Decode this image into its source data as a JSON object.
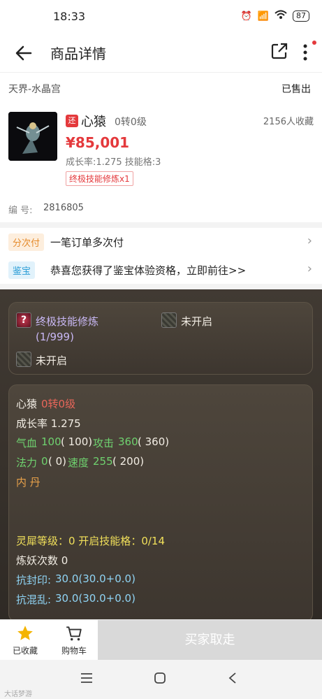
{
  "status_bar": {
    "time": "18:33",
    "battery": "87"
  },
  "header": {
    "title": "商品详情"
  },
  "server": {
    "name": "天界-水晶宫",
    "status": "已售出"
  },
  "product": {
    "tag": "还",
    "name": "心猿",
    "level": "0转0级",
    "favorites": "2156人收藏",
    "price": "¥85,001",
    "stats": "成长率:1.275 技能格:3",
    "skill_tag": "终极技能修炼x1",
    "serial_label": "编  号:",
    "serial": "2816805"
  },
  "promos": [
    {
      "badge": "分次付",
      "text": "一笔订单多次付"
    },
    {
      "badge": "鉴宝",
      "text": "恭喜您获得了鉴宝体验资格，立即前往>>"
    }
  ],
  "game_panel": {
    "skills": [
      {
        "name": "终极技能修炼",
        "count": "(1/999)"
      },
      {
        "name": "未开启"
      },
      {
        "name": "未开启"
      }
    ],
    "info": {
      "name": "心猿",
      "name_level": "0转0级",
      "growth": "成长率 1.275",
      "hp_label": "气血",
      "hp_value": "100",
      "hp_paren": "( 100)",
      "atk_label": "攻击",
      "atk_value": "360",
      "atk_paren": "( 360)",
      "mp_label": "法力",
      "mp_value": "0",
      "mp_paren": "( 0)",
      "spd_label": "速度",
      "spd_value": "255",
      "spd_paren": "( 200)",
      "neidan": "内    丹",
      "lingxi": "灵犀等级：0 开启技能格：0/14",
      "lianyao": "炼妖次数 0",
      "kangfeng_label": "抗封印:",
      "kangfeng_value": "30.0(30.0+0.0)",
      "kanghun_label": "抗混乱:",
      "kanghun_value": "30.0(30.0+0.0)"
    }
  },
  "bottom_bar": {
    "collected": "已收藏",
    "cart": "购物车",
    "buy": "买家取走"
  },
  "watermark": "大话梦游"
}
